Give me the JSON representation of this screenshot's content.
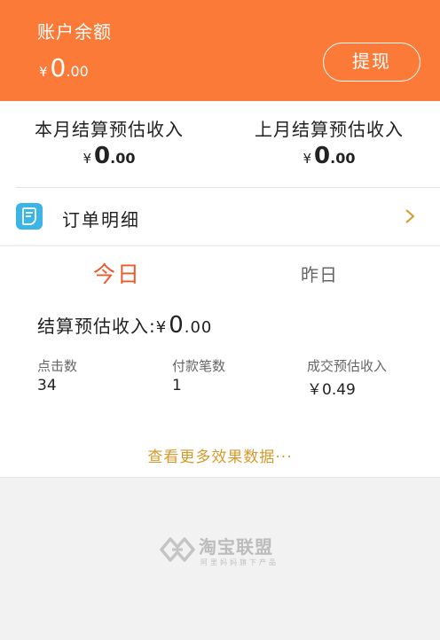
{
  "header": {
    "title": "账户余额",
    "balance": {
      "currency": "¥",
      "integer": "0",
      "decimal": ".00"
    },
    "withdraw_label": "提现",
    "background_color": "#fb7a38"
  },
  "monthly": {
    "this_month": {
      "label": "本月结算预估收入",
      "currency": "¥",
      "integer": "0",
      "decimal": ".00"
    },
    "last_month": {
      "label": "上月结算预估收入",
      "currency": "¥",
      "integer": "0",
      "decimal": ".00"
    }
  },
  "orders": {
    "label": "订单明细",
    "icon": "document-icon",
    "chevron": "chevron-right-icon"
  },
  "stats": {
    "tabs": [
      {
        "label": "今日",
        "active": true
      },
      {
        "label": "昨日",
        "active": false
      }
    ],
    "settlement": {
      "label": "结算预估收入:",
      "currency": "¥",
      "integer": "0",
      "decimal": ".00"
    },
    "metrics": [
      {
        "label": "点击数",
        "value": "34"
      },
      {
        "label": "付款笔数",
        "value": "1"
      },
      {
        "label": "成交预估收入",
        "value": "￥0.49"
      }
    ],
    "more_link": "查看更多效果数据···"
  },
  "footer": {
    "brand_name": "淘宝联盟",
    "brand_slogan": "阿里妈妈旗下产品"
  },
  "colors": {
    "accent": "#fb7a38",
    "active_tab": "#e85a2a",
    "link": "#d49a2c",
    "icon_blue": "#3db4e6"
  }
}
